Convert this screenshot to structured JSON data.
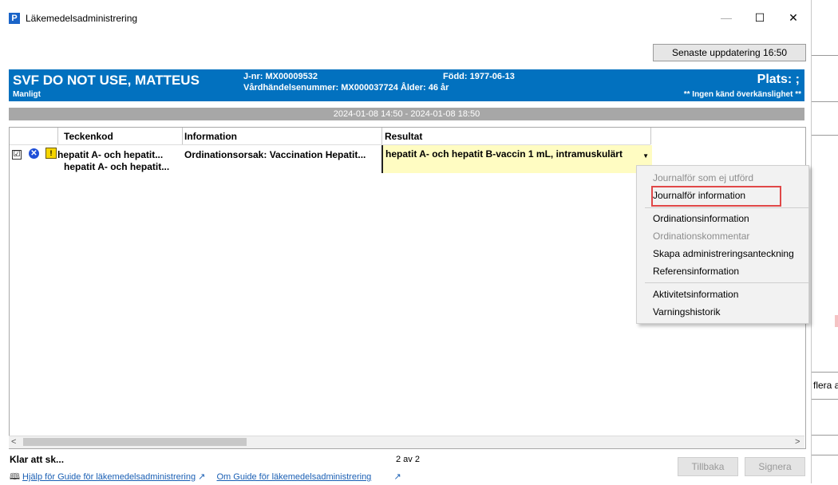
{
  "window": {
    "title": "Läkemedelsadministrering",
    "app_icon": "P",
    "controls": {
      "minimize": "—",
      "maximize": "☐",
      "close": "✕"
    }
  },
  "toolbar": {
    "update_button": "Senaste uppdatering 16:50"
  },
  "patient": {
    "name": "SVF DO NOT USE, MATTEUS",
    "gender": "Manligt",
    "jnr": "J-nr: MX00009532",
    "vardhandelse": "Vårdhändelsenummer: MX000037724 Ålder: 46 år",
    "fodd": "Född: 1977-06-13",
    "plats": "Plats: ;",
    "allergy": "** Ingen känd överkänslighet **"
  },
  "date_range": "2024-01-08 14:50  - 2024-01-08 18:50",
  "table": {
    "headers": [
      "Teckenkod",
      "Information",
      "Resultat"
    ],
    "rows": [
      {
        "checked": "☑",
        "status_icon": "x-circle-icon",
        "flag_icon": "warning-flag-icon",
        "teckenkod_1": "hepatit A- och hepatit...",
        "teckenkod_2": "hepatit A- och hepatit...",
        "information": "Ordinationsorsak: Vaccination Hepatit...",
        "resultat": "hepatit A- och hepatit B-vaccin 1 mL, intramuskulärt"
      }
    ]
  },
  "context_menu": {
    "items": [
      {
        "label": "Journalför som ej utförd",
        "enabled": false
      },
      {
        "label": "Journalför information",
        "enabled": true,
        "highlighted": true
      },
      {
        "label": "Ordinationsinformation",
        "enabled": true
      },
      {
        "label": "Ordinationskommentar",
        "enabled": false
      },
      {
        "label": "Skapa administreringsanteckning",
        "enabled": true
      },
      {
        "label": "Referensinformation",
        "enabled": true
      },
      {
        "label": "Aktivitetsinformation",
        "enabled": true
      },
      {
        "label": "Varningshistorik",
        "enabled": true
      }
    ]
  },
  "status": {
    "text": "Klar att sk...",
    "pager": "2 av 2"
  },
  "buttons": {
    "back": "Tillbaka",
    "sign": "Signera"
  },
  "links": {
    "help": "Hjälp för Guide för läkemedelsadministrering",
    "about": "Om Guide för läkemedelsadministrering"
  },
  "background": {
    "partial_text": "flera ar"
  },
  "colors": {
    "header_blue": "#0271bf",
    "result_yellow": "#fffcc2",
    "highlight_red": "#e04848"
  }
}
